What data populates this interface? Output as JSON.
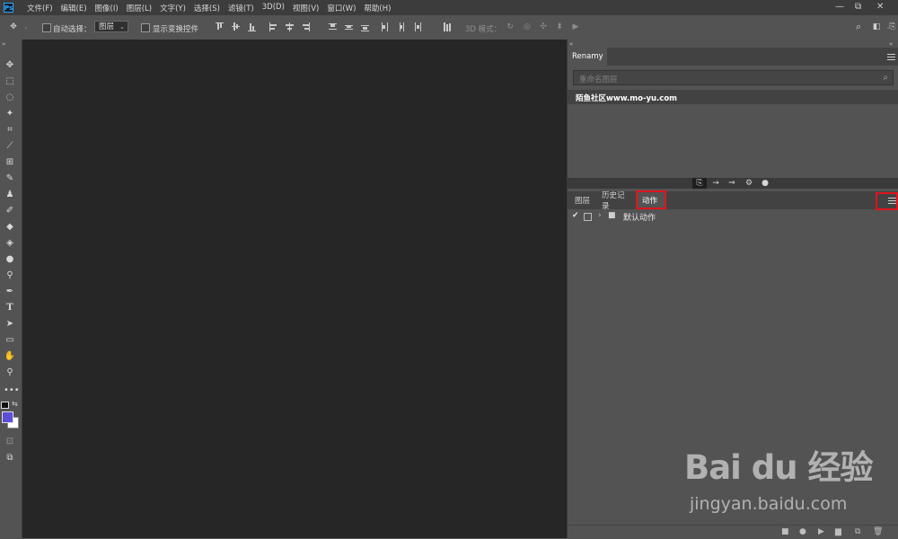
{
  "app": {
    "logo": "Ps"
  },
  "menu": [
    "文件(F)",
    "编辑(E)",
    "图像(I)",
    "图层(L)",
    "文字(Y)",
    "选择(S)",
    "滤镜(T)",
    "3D(D)",
    "视图(V)",
    "窗口(W)",
    "帮助(H)"
  ],
  "window_controls": {
    "minimize": "—",
    "restore": "⧉",
    "close": "✕"
  },
  "options": {
    "auto_select_label": "自动选择：",
    "auto_select_value": "图层",
    "show_transform_label": "显示变换控件",
    "mode_3d_label": "3D 模式："
  },
  "renamy": {
    "tab_label": "Renamy",
    "search_placeholder": "重命名图层",
    "row_text": "陌鱼社区www.mo-yu.com"
  },
  "bottom_panel": {
    "tabs": [
      "图层",
      "历史记录",
      "动作"
    ],
    "active_tab": "动作",
    "action_set_name": "默认动作"
  },
  "colors": {
    "foreground": "#5a4fd6",
    "background": "#ffffff",
    "highlight": "#e0141e"
  },
  "watermark": {
    "logo": "Bai du 经验",
    "url": "jingyan.baidu.com"
  }
}
